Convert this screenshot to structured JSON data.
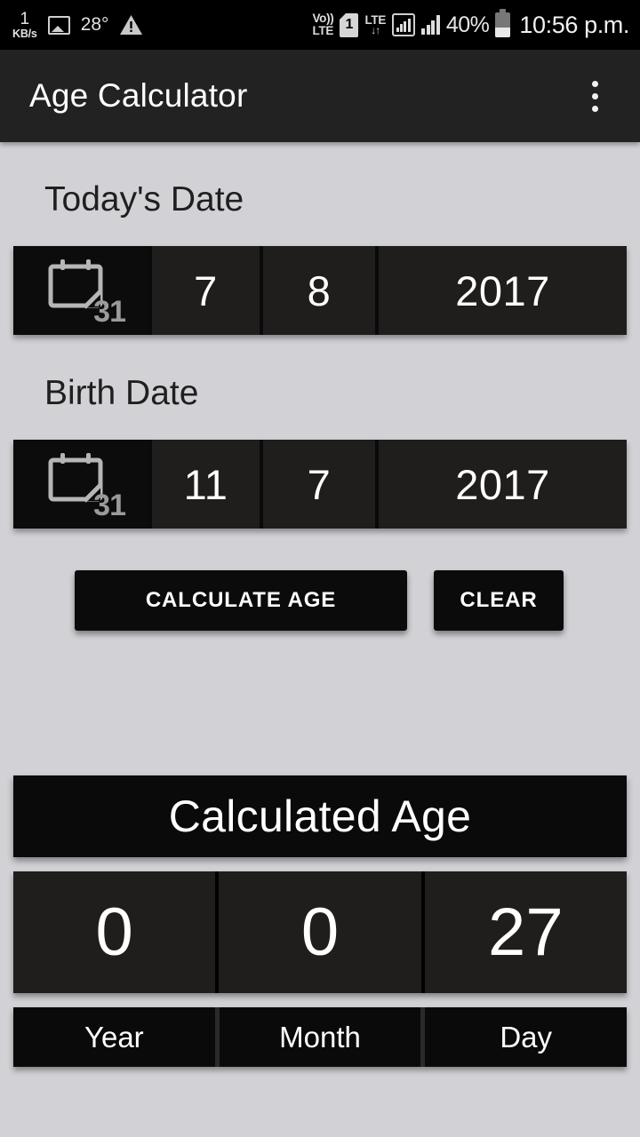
{
  "status_bar": {
    "net_speed_value": "1",
    "net_speed_unit": "KB/s",
    "screenshot_icon": "image-icon",
    "temperature": "28°",
    "warning_icon": "warning-triangle-icon",
    "volte_line1": "Vo))",
    "volte_line2": "LTE",
    "sim_slot": "1",
    "lte_label": "LTE",
    "lte_arrows": "↓↑",
    "data_signal_icon": "boxed-signal-icon",
    "signal_icon": "signal-bars-icon",
    "battery_percent": "40%",
    "battery_icon": "battery-icon",
    "clock": "10:56 p.m."
  },
  "app_bar": {
    "title": "Age Calculator",
    "overflow_icon": "overflow-menu-icon"
  },
  "today": {
    "label": "Today's Date",
    "calendar_icon": "calendar-icon",
    "calendar_icon_day": "31",
    "day": "7",
    "month": "8",
    "year": "2017"
  },
  "birth": {
    "label": "Birth Date",
    "calendar_icon": "calendar-icon",
    "calendar_icon_day": "31",
    "day": "11",
    "month": "7",
    "year": "2017"
  },
  "actions": {
    "calculate_label": "CALCULATE AGE",
    "clear_label": "CLEAR"
  },
  "result": {
    "heading": "Calculated Age",
    "values": [
      "0",
      "0",
      "27"
    ],
    "labels": [
      "Year",
      "Month",
      "Day"
    ]
  },
  "colors": {
    "background": "#d2d2d6",
    "app_bar": "#222222",
    "cell": "#201e1d",
    "cell_dark": "#0a0a0a",
    "text_light": "#ffffff",
    "text_dark": "#1f1f1f"
  }
}
